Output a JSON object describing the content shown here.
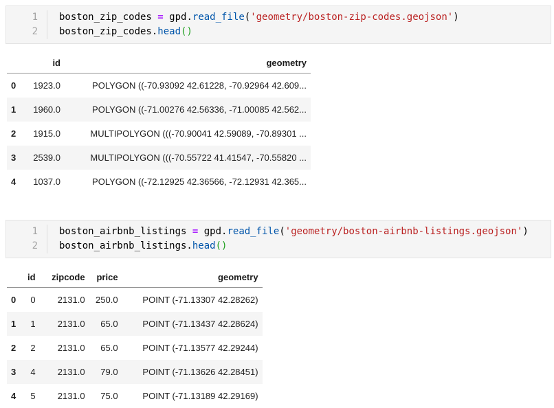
{
  "syntax_colors": {
    "operator": "#AA22FF",
    "property": "#0055AA",
    "string": "#BA2121",
    "matched_bracket": "#20A020",
    "default_text": "#000000",
    "line_number": "#A3A3A3",
    "cell_background": "#F5F5F5",
    "row_stripe": "#F5F5F5"
  },
  "code_cells": [
    {
      "lines": [
        {
          "no": "1",
          "tokens": [
            [
              "plain",
              "boston_zip_codes "
            ],
            [
              "op",
              "="
            ],
            [
              "plain",
              " gpd."
            ],
            [
              "prop",
              "read_file"
            ],
            [
              "plain",
              "("
            ],
            [
              "str",
              "'geometry/boston-zip-codes.geojson'"
            ],
            [
              "plain",
              ")"
            ]
          ]
        },
        {
          "no": "2",
          "tokens": [
            [
              "plain",
              "boston_zip_codes."
            ],
            [
              "prop",
              "head"
            ],
            [
              "bracket",
              "()"
            ]
          ]
        }
      ]
    },
    {
      "lines": [
        {
          "no": "1",
          "tokens": [
            [
              "plain",
              "boston_airbnb_listings "
            ],
            [
              "op",
              "="
            ],
            [
              "plain",
              " gpd."
            ],
            [
              "prop",
              "read_file"
            ],
            [
              "plain",
              "("
            ],
            [
              "str",
              "'geometry/boston-airbnb-listings.geojson'"
            ],
            [
              "plain",
              ")"
            ]
          ]
        },
        {
          "no": "2",
          "tokens": [
            [
              "plain",
              "boston_airbnb_listings."
            ],
            [
              "prop",
              "head"
            ],
            [
              "bracket",
              "()"
            ]
          ]
        }
      ]
    }
  ],
  "tables": [
    {
      "name": "boston_zip_codes.head()",
      "headers": [
        "",
        "id",
        "geometry"
      ],
      "rows": [
        [
          "0",
          "1923.0",
          "POLYGON ((-70.93092 42.61228, -70.92964 42.609..."
        ],
        [
          "1",
          "1960.0",
          "POLYGON ((-71.00276 42.56336, -71.00085 42.562..."
        ],
        [
          "2",
          "1915.0",
          "MULTIPOLYGON (((-70.90041 42.59089, -70.89301 ..."
        ],
        [
          "3",
          "2539.0",
          "MULTIPOLYGON (((-70.55722 41.41547, -70.55820 ..."
        ],
        [
          "4",
          "1037.0",
          "POLYGON ((-72.12925 42.36566, -72.12931 42.365..."
        ]
      ]
    },
    {
      "name": "boston_airbnb_listings.head()",
      "headers": [
        "",
        "id",
        "zipcode",
        "price",
        "geometry"
      ],
      "rows": [
        [
          "0",
          "0",
          "2131.0",
          "250.0",
          "POINT (-71.13307 42.28262)"
        ],
        [
          "1",
          "1",
          "2131.0",
          "65.0",
          "POINT (-71.13437 42.28624)"
        ],
        [
          "2",
          "2",
          "2131.0",
          "65.0",
          "POINT (-71.13577 42.29244)"
        ],
        [
          "3",
          "4",
          "2131.0",
          "79.0",
          "POINT (-71.13626 42.28451)"
        ],
        [
          "4",
          "5",
          "2131.0",
          "75.0",
          "POINT (-71.13189 42.29169)"
        ]
      ]
    }
  ]
}
